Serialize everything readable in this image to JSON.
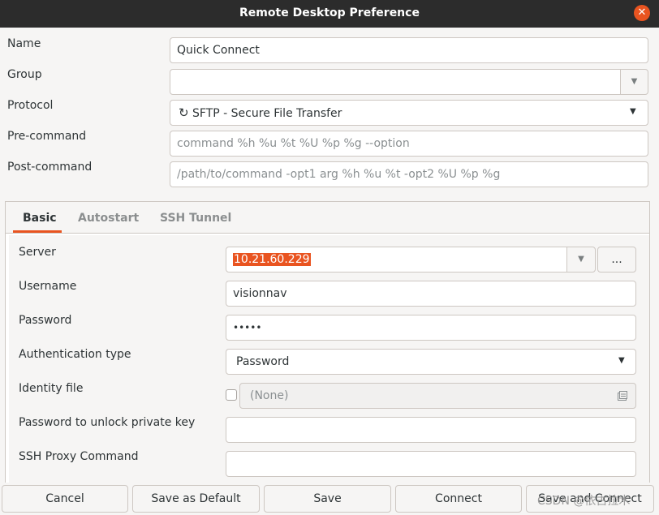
{
  "window": {
    "title": "Remote Desktop Preference",
    "close_glyph": "✕"
  },
  "form": {
    "name_label": "Name",
    "name_value": "Quick Connect",
    "group_label": "Group",
    "group_value": "",
    "protocol_label": "Protocol",
    "protocol_icon": "↻",
    "protocol_value": "SFTP - Secure File Transfer",
    "precommand_label": "Pre-command",
    "precommand_placeholder": "command %h %u %t %U %p %g --option",
    "postcommand_label": "Post-command",
    "postcommand_placeholder": "/path/to/command -opt1 arg %h %u %t -opt2 %U %p %g"
  },
  "tabs": [
    {
      "label": "Basic"
    },
    {
      "label": "Autostart"
    },
    {
      "label": "SSH Tunnel"
    }
  ],
  "basic": {
    "server_label": "Server",
    "server_value": "10.21.60.229",
    "server_browse": "...",
    "username_label": "Username",
    "username_value": "visionnav",
    "password_label": "Password",
    "password_value": "•••••",
    "auth_label": "Authentication type",
    "auth_value": "Password",
    "identity_label": "Identity file",
    "identity_value": "(None)",
    "identity_icon": "file-chooser-icon",
    "unlock_label": "Password to unlock private key",
    "unlock_value": "",
    "proxy_label": "SSH Proxy Command",
    "proxy_value": ""
  },
  "buttons": {
    "cancel": "Cancel",
    "save_default": "Save as Default",
    "save": "Save",
    "connect": "Connect",
    "save_connect": "Save and Connect"
  },
  "watermark": "CSDN @依古拉木",
  "colors": {
    "accent": "#e95420",
    "titlebar": "#2c2c2c"
  }
}
